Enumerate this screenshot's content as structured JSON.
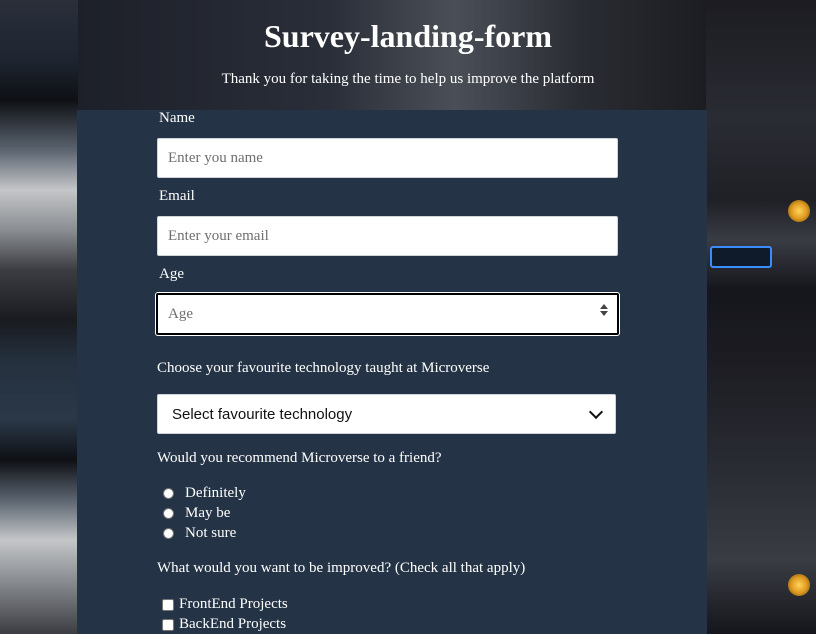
{
  "header": {
    "title": "Survey-landing-form",
    "description": "Thank you for taking the time to help us improve the platform"
  },
  "form": {
    "name": {
      "label": "Name",
      "placeholder": "Enter you name",
      "value": ""
    },
    "email": {
      "label": "Email",
      "placeholder": "Enter your email",
      "value": ""
    },
    "age": {
      "label": "Age",
      "placeholder": "Age",
      "value": ""
    },
    "technology": {
      "label": "Choose your favourite technology taught at Microverse",
      "selected": "Select favourite technology"
    },
    "recommend": {
      "question": "Would you recommend Microverse to a friend?",
      "options": [
        "Definitely",
        "May be",
        "Not sure"
      ]
    },
    "improve": {
      "question": "What would you want to be improved? (Check all that apply)",
      "options": [
        "FrontEnd Projects",
        "BackEnd Projects"
      ]
    }
  },
  "colors": {
    "panel": "#243345",
    "text": "#ffffff",
    "focus_border": "#000000"
  }
}
